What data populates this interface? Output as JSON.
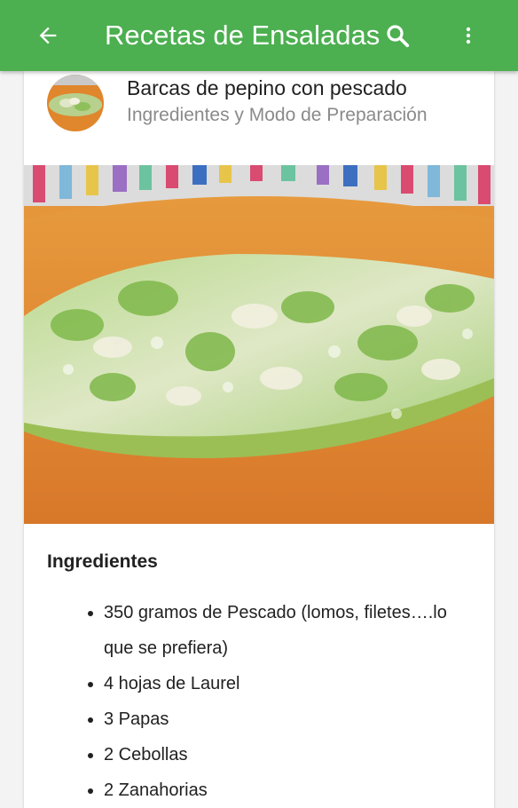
{
  "appbar": {
    "title": "Recetas de Ensaladas",
    "back_icon": "arrow-back-icon",
    "search_icon": "search-icon",
    "more_icon": "more-vert-icon",
    "color": "#4caf50"
  },
  "post": {
    "title": "Barcas de pepino con pescado",
    "subtitle": "Ingredientes y Modo de Preparación"
  },
  "content": {
    "section_title": "Ingredientes",
    "ingredients": [
      "350 gramos de Pescado (lomos, filetes….lo que se prefiera)",
      "4 hojas de Laurel",
      "3 Papas",
      "2 Cebollas",
      "2 Zanahorias"
    ]
  }
}
